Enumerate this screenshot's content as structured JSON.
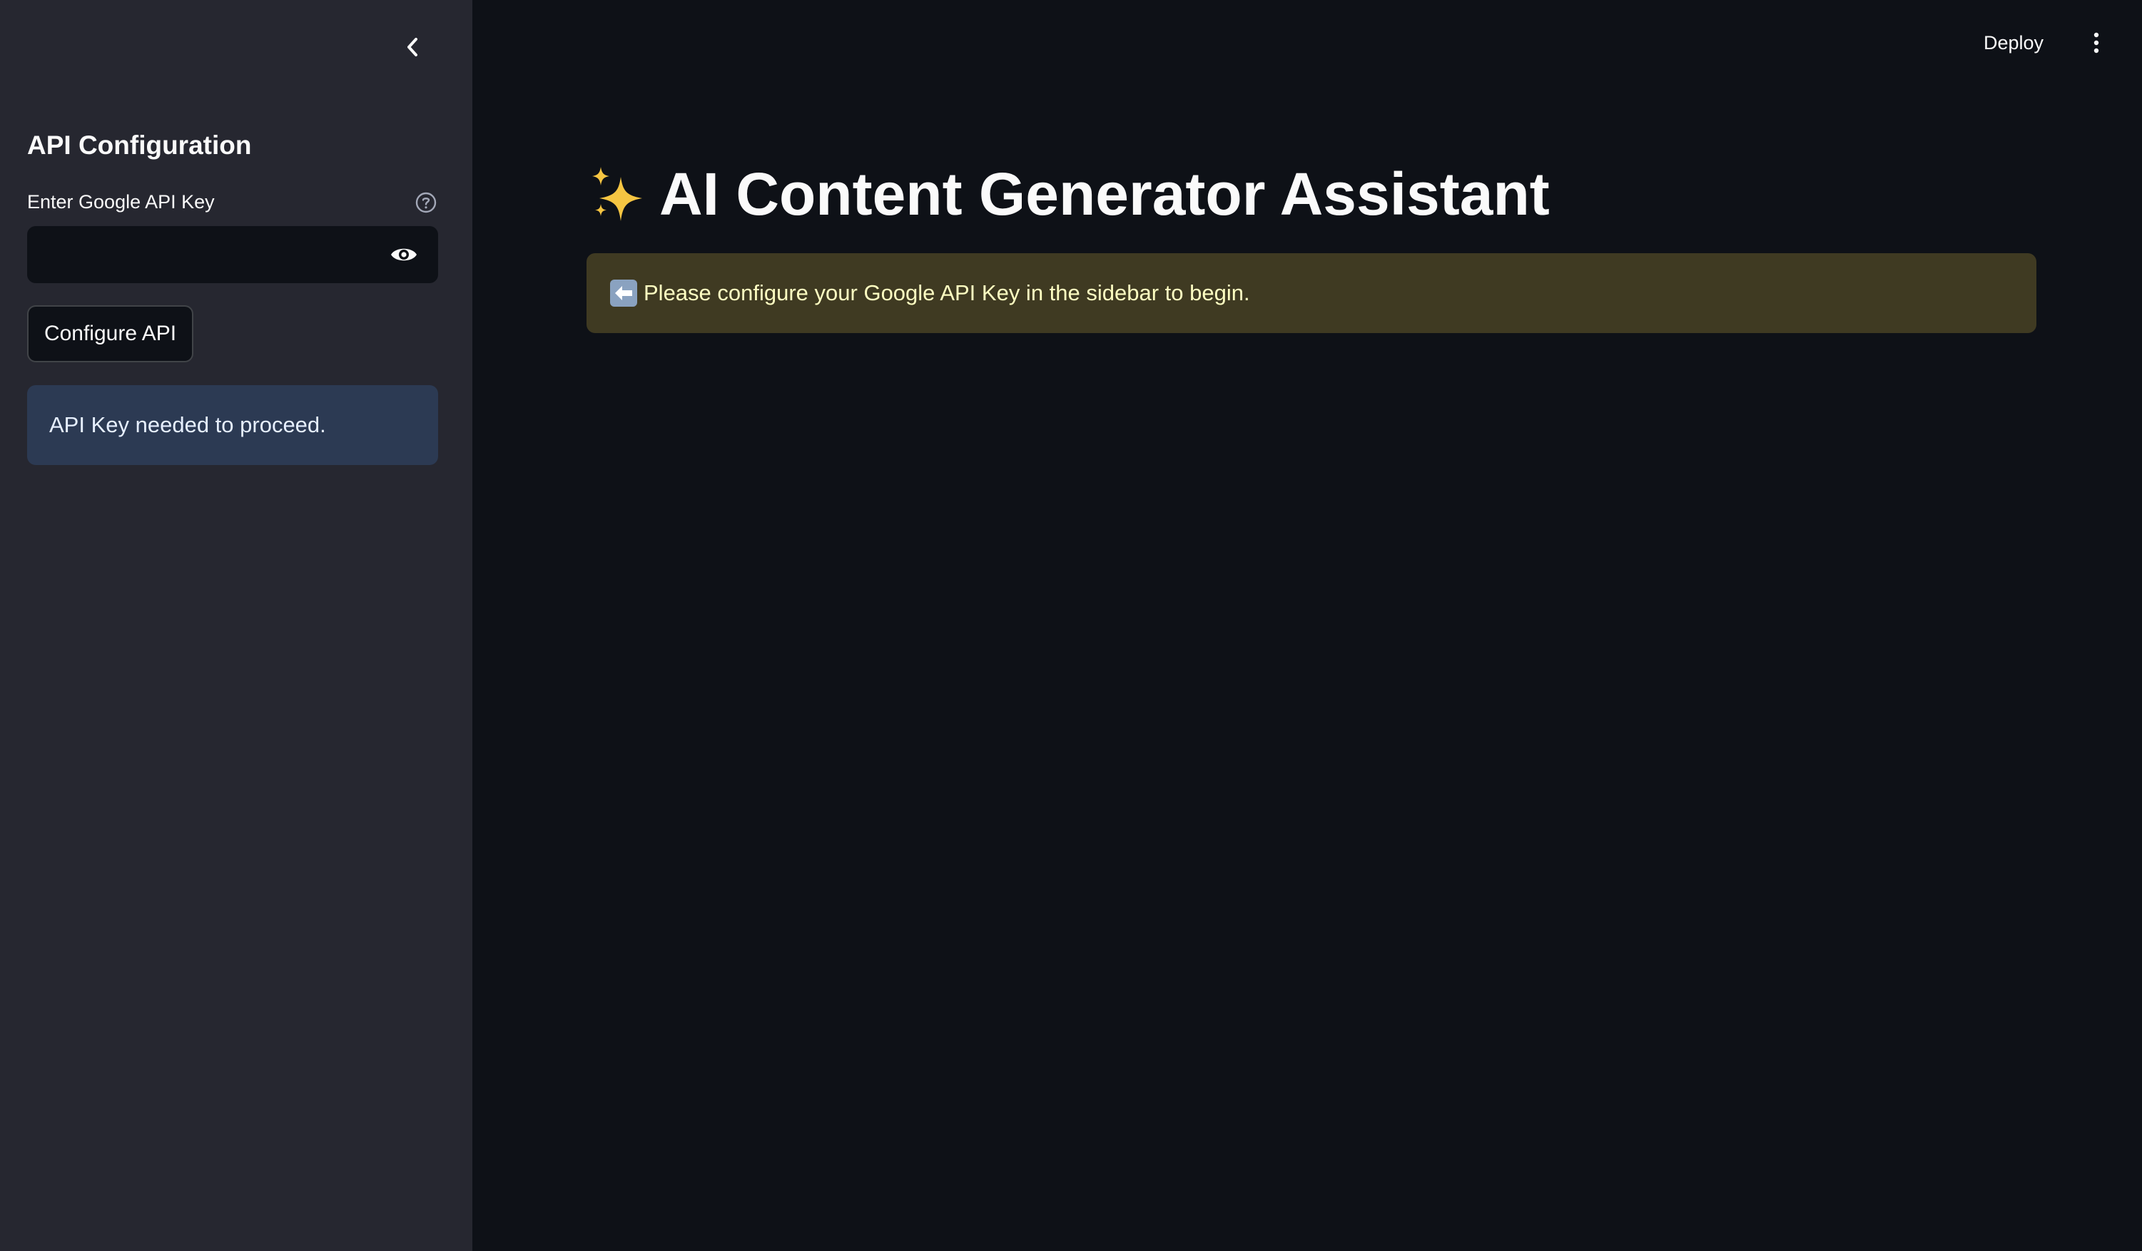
{
  "sidebar": {
    "title": "API Configuration",
    "api_key_field": {
      "label": "Enter Google API Key",
      "value": "",
      "placeholder": ""
    },
    "configure_button_label": "Configure API",
    "info_message": "API Key needed to proceed."
  },
  "header": {
    "deploy_label": "Deploy"
  },
  "main": {
    "title": "AI Content Generator Assistant",
    "title_icon": "sparkles-icon",
    "warning_icon": "left-arrow-icon",
    "warning_message": "Please configure your Google API Key in the sidebar to begin."
  },
  "colors": {
    "app_background": "#0e1117",
    "sidebar_background": "#262730",
    "info_background": "#2c3a53",
    "warning_background": "#3f3a22",
    "warning_text": "#ffffc2"
  }
}
